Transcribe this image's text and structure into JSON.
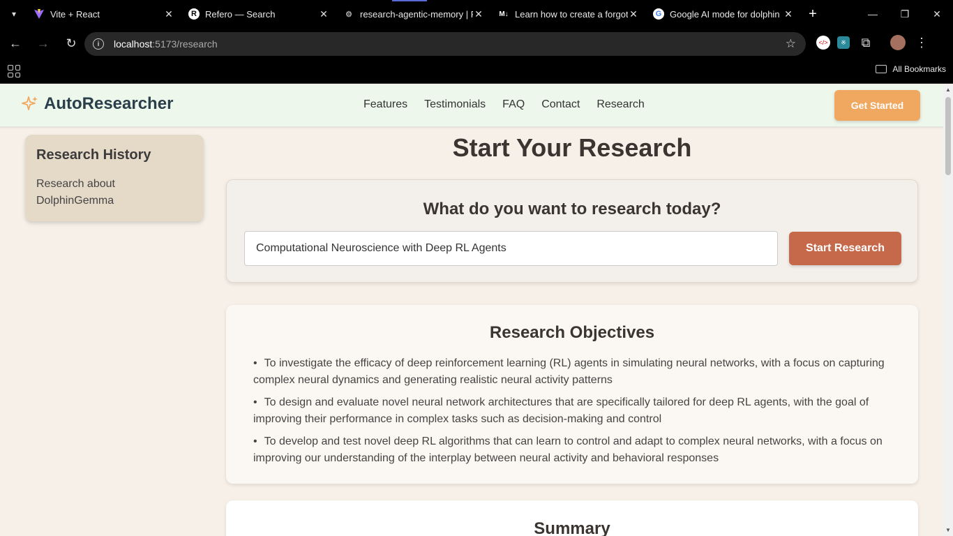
{
  "browser": {
    "tabs": [
      {
        "title": "Vite + React",
        "favicon": "vite-icon",
        "active": false
      },
      {
        "title": "Refero — Search",
        "favicon": "refero-icon",
        "active": false
      },
      {
        "title": "research-agentic-memory | F",
        "favicon": "github-icon",
        "active": true
      },
      {
        "title": "Learn how to create a forgot",
        "favicon": "medium-icon",
        "active": false
      },
      {
        "title": "Google AI mode for dolphin",
        "favicon": "google-icon",
        "active": false
      }
    ],
    "url_host": "localhost",
    "url_path": ":5173/research",
    "bookmarks_label": "All Bookmarks"
  },
  "app": {
    "brand": "AutoResearcher",
    "nav": [
      "Features",
      "Testimonials",
      "FAQ",
      "Contact",
      "Research"
    ],
    "cta_label": "Get Started",
    "accent": "#f0a860",
    "primary_button_color": "#c5694a"
  },
  "sidebar": {
    "title": "Research History",
    "items": [
      "Research about DolphinGemma"
    ]
  },
  "main": {
    "title": "Start Your Research",
    "prompt": "What do you want to research today?",
    "query_value": "Computational Neuroscience with Deep RL Agents",
    "submit_label": "Start Research",
    "objectives_title": "Research Objectives",
    "objectives": [
      "To investigate the efficacy of deep reinforcement learning (RL) agents in simulating neural networks, with a focus on capturing complex neural dynamics and generating realistic neural activity patterns",
      "To design and evaluate novel neural network architectures that are specifically tailored for deep RL agents, with the goal of improving their performance in complex tasks such as decision-making and control",
      "To develop and test novel deep RL algorithms that can learn to control and adapt to complex neural networks, with a focus on improving our understanding of the interplay between neural activity and behavioral responses"
    ],
    "summary_title": "Summary"
  }
}
